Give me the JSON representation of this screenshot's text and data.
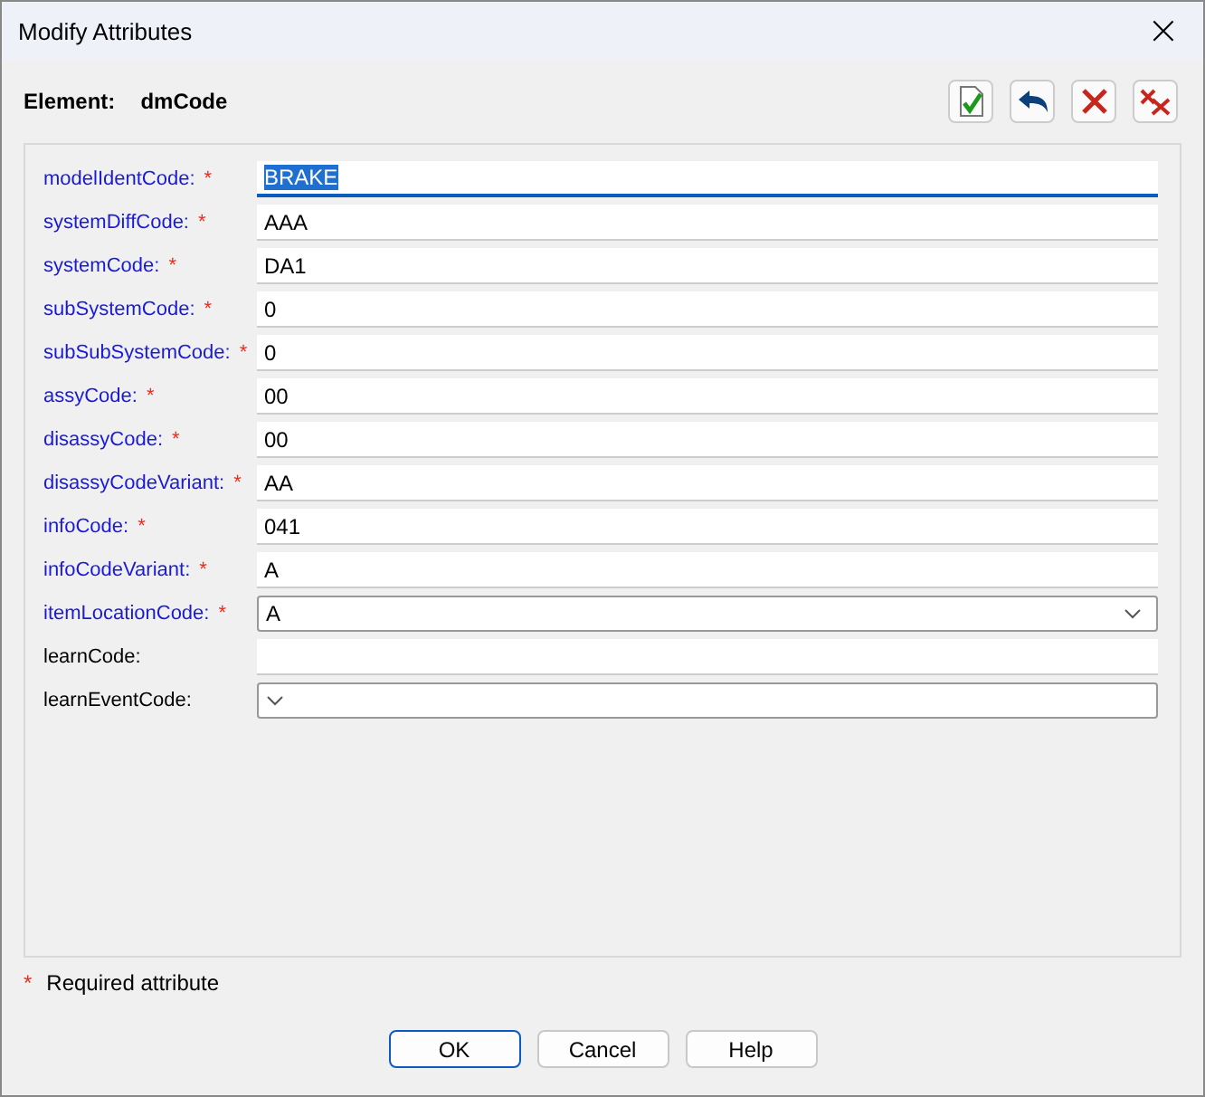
{
  "window": {
    "title": "Modify Attributes",
    "close": "×"
  },
  "element": {
    "label": "Element:",
    "value": "dmCode"
  },
  "attributes": [
    {
      "label": "modelIdentCode:",
      "required": true,
      "kind": "text",
      "value": "BRAKE",
      "selected": true
    },
    {
      "label": "systemDiffCode:",
      "required": true,
      "kind": "text",
      "value": "AAA",
      "selected": false
    },
    {
      "label": "systemCode:",
      "required": true,
      "kind": "text",
      "value": "DA1",
      "selected": false
    },
    {
      "label": "subSystemCode:",
      "required": true,
      "kind": "text",
      "value": "0",
      "selected": false
    },
    {
      "label": "subSubSystemCode:",
      "required": true,
      "kind": "text",
      "value": "0",
      "selected": false
    },
    {
      "label": "assyCode:",
      "required": true,
      "kind": "text",
      "value": "00",
      "selected": false
    },
    {
      "label": "disassyCode:",
      "required": true,
      "kind": "text",
      "value": "00",
      "selected": false
    },
    {
      "label": "disassyCodeVariant:",
      "required": true,
      "kind": "text",
      "value": "AA",
      "selected": false
    },
    {
      "label": "infoCode:",
      "required": true,
      "kind": "text",
      "value": "041",
      "selected": false
    },
    {
      "label": "infoCodeVariant:",
      "required": true,
      "kind": "text",
      "value": "A",
      "selected": false
    },
    {
      "label": "itemLocationCode:",
      "required": true,
      "kind": "dropdown",
      "value": "A",
      "selected": false
    },
    {
      "label": "learnCode:",
      "required": false,
      "kind": "text",
      "selected": false
    },
    {
      "label": "learnEventCode:",
      "required": false,
      "kind": "dropdown",
      "selected": false
    }
  ],
  "required_mark": "*",
  "legend": "Required attribute",
  "buttons": [
    {
      "label": "OK",
      "default": true
    },
    {
      "label": "Cancel",
      "default": false
    },
    {
      "label": "Help",
      "default": false
    }
  ]
}
